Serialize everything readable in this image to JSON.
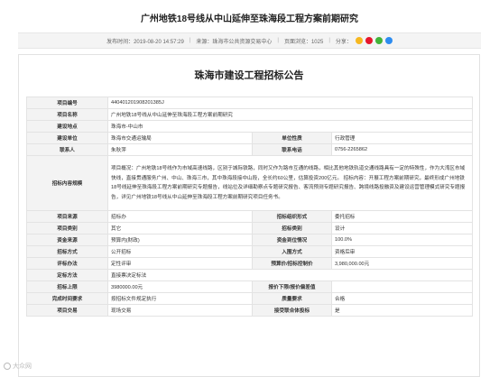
{
  "page": {
    "title": "广州地铁18号线从中山延伸至珠海段工程方案前期研究"
  },
  "meta": {
    "publish_time": "发布时间：2019-08-20 14:57:29",
    "source": "来源：珠海市公共资源交易中心",
    "views": "页面浏览：1025",
    "share_label": "分享："
  },
  "doc": {
    "title": "珠海市建设工程招标公告"
  },
  "table": {
    "project_no_label": "项目编号",
    "project_no": "440401201908201385J",
    "project_name_label": "项目名称",
    "project_name": "广州地铁18号线从中山延伸至珠海段工程方案前期研究",
    "location_label": "建设地点",
    "location": "珠海市-中山市",
    "builder_label": "建设单位",
    "builder": "珠海市交通运输局",
    "nature_label": "单位性质",
    "nature": "行政管理",
    "contact_label": "联系人",
    "contact": "朱秋萍",
    "phone_label": "联系电话",
    "phone": "0756-2265862",
    "scope_label": "招标内容规模",
    "scope": "项目概况：广州地铁18号线作为市域高速线路，区别于城际铁路，同时又作为路市互通的线路，相比其他地铁轨道交通线路具有一定的特殊性，作为大湾区市域快线，直接贯通服务广州、中山、珠海三市，其中珠海段接中山段，全长约60公里，估算投资200亿元。 招标内容：开展工程方案前期研究，最终形成广州地铁18号线延伸至珠海段工程方案前期研究专题报告，线站位及详细勘察点专题研究报告、客流预测专题研究报告、跨境线路投融资及建设运营管理模式研究专题报告，详见广州地铁18号线从中山延伸至珠海段工程方案前期研究项目任务书。",
    "source_label": "项目来源",
    "source_val": "招标办",
    "method_label": "招标组织形式",
    "method": "委托招标",
    "category_label": "项目类别",
    "category": "其它",
    "type_label": "招标类别",
    "type": "设计",
    "funds_label": "资金来源",
    "funds": "预算内(财政)",
    "ratio_label": "资金到位情况",
    "ratio": "100.0%",
    "bid_method_label": "招标方式",
    "bid_method": "公开招标",
    "entry_label": "入围方式",
    "entry": "资格后审",
    "eval_label": "评标办法",
    "eval": "定性评审",
    "ceiling_label": "预算价/招标控制价",
    "ceiling": "3,980,000.00元",
    "decide_label": "定标方法",
    "decide": "直接票决定标法",
    "limit_label": "招标上限",
    "limit": "3980000.00元",
    "floor_label": "报价下限/报价偏差值",
    "floor": "",
    "deadline_label": "完成时间要求",
    "deadline": "按招标文件规定执行",
    "quality_label": "质量要求",
    "quality": "合格",
    "venue_label": "项目交易",
    "venue": "现场交易",
    "union_label": "接受联合体投标",
    "union": "是"
  },
  "watermark": {
    "text": "大众网"
  }
}
